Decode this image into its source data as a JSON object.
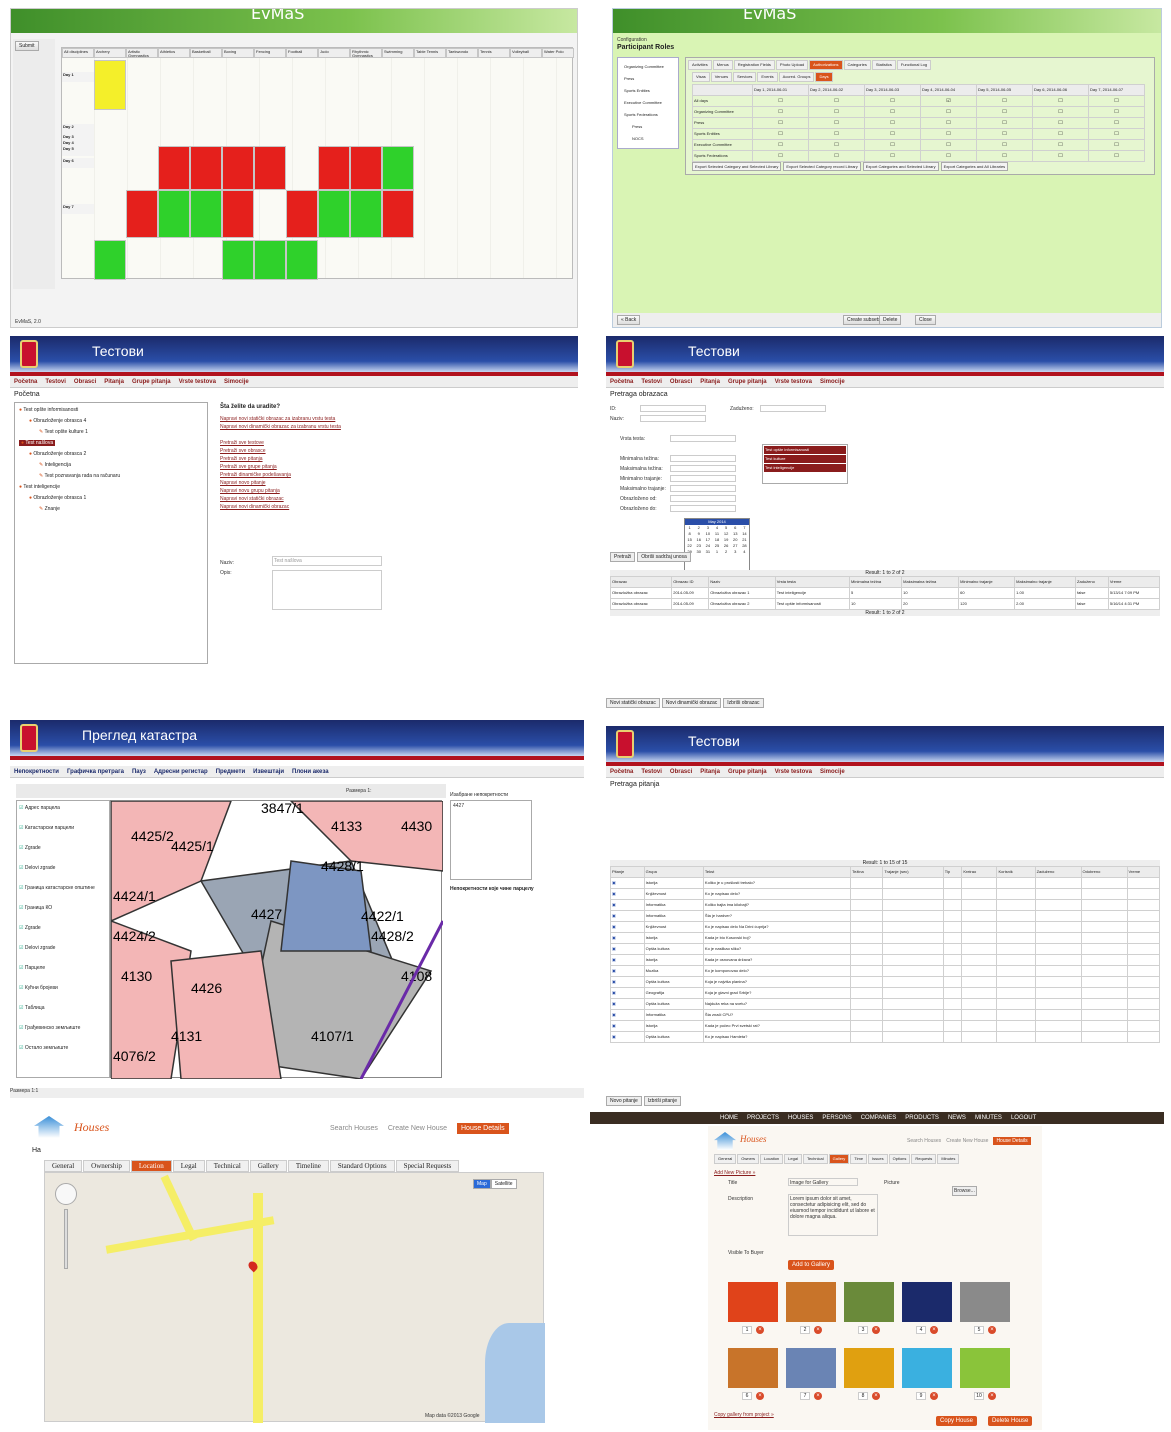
{
  "evmas_schedule": {
    "title": "EvMaS",
    "columns": [
      "All disciplines",
      "Archery",
      "Artistic Gymnastics",
      "Athletics",
      "Basketball",
      "Boxing",
      "Fencing",
      "Football",
      "Judo",
      "Rhythmic Gymnastics",
      "Swimming",
      "Table Tennis",
      "Taekwondo",
      "Tennis",
      "Volleyball",
      "Water Polo"
    ],
    "days": [
      "Day 1",
      "Day 2",
      "Day 3",
      "Day 4",
      "Day 5",
      "Day 6",
      "Day 7"
    ],
    "footer": "EvMaS, 2.0"
  },
  "evmas_config": {
    "title": "EvMaS",
    "breadcrumb": "Configuration",
    "page_title": "Participant Roles",
    "tabs": [
      "Activities",
      "Menus",
      "Registration Fields",
      "Photo Upload",
      "Authorizations",
      "Categories",
      "Statistics",
      "Functional Log"
    ],
    "subtabs": [
      "Visas",
      "Venues",
      "Services",
      "Events",
      "Accred. Groups",
      "Days"
    ],
    "tree": [
      "Organizing Committee",
      "Press",
      "Sports Entities",
      "Executive Committee",
      "Sports Federations",
      "Press",
      "NOCS"
    ],
    "day_headers": [
      "Day 1, 2014-06-01",
      "Day 2, 2014-06-02",
      "Day 3, 2014-06-03",
      "Day 4, 2014-06-04",
      "Day 5, 2014-06-05",
      "Day 6, 2014-06-06",
      "Day 7, 2014-06-07"
    ],
    "rows": [
      "All days",
      "Organizing Committee",
      "Press",
      "Sports Entities",
      "Executive Committee",
      "Sports Federations"
    ],
    "export_buttons": [
      "Export Selected Category and Selected Library",
      "Export Selected Category record Library",
      "Export Categories and Selected Library",
      "Export Categories and All Libraries"
    ],
    "buttons": [
      "« Back",
      "Create subsets",
      "Delete",
      "Close"
    ]
  },
  "testovi_home": {
    "appname": "Тестови",
    "menu": [
      "Početna",
      "Testovi",
      "Obrasci",
      "Pitanja",
      "Grupe pitanja",
      "Vrste testova",
      "Simocije"
    ],
    "page_title": "Početna",
    "tree": [
      "Test opšte informisanosti",
      "Obrazloženje obrasca 4",
      "Test opšte kulture 1",
      "Test našlova",
      "Obrazloženje obrasca 2",
      "Inteligencija",
      "Test poznavanja rada na računaru",
      "Test inteligencije",
      "Obrazloženje obrasca 1",
      "Znanje"
    ],
    "heading": "Šta želite da uradite?",
    "links": [
      "Napravi novi statički obrazac za izabranu vrstu testa",
      "Napravi novi dinamički obrazac za izabranu vrstu testa",
      "Pretraži sve testove",
      "Pretraži sve obrasce",
      "Pretraži sve pitanja",
      "Pretraži sve grupe pitanja",
      "Pretraži dinamičke podešavanja",
      "Napravi novo pitanje",
      "Napravi novu grupu pitanja",
      "Napravi novi statički obrazac",
      "Napravi novi dinamički obrazac"
    ],
    "form_labels": [
      "Naziv:",
      "Opis:"
    ],
    "form_value": "Test našlova"
  },
  "testovi_search": {
    "appname": "Тестови",
    "page_title": "Pretraga obrazaca",
    "labels": [
      "ID:",
      "Naziv:",
      "Zaduženo:",
      "Vrsta testa:",
      "Minimalna težina:",
      "Maksimalna težina:",
      "Minimalno trajanje:",
      "Maksimalno trajanje:",
      "Obrazloženo od:",
      "Obrazloženo do:"
    ],
    "test_types": [
      "Test opšte informisanosti",
      "Test kulture",
      "Test inteligencije"
    ],
    "calendar_month": "May 2014",
    "buttons": [
      "Pretraži",
      "Obriši sadržaj unosa"
    ],
    "result": "Result: 1 to 2 of 2",
    "columns": [
      "Obrazac",
      "Obrazac ID",
      "Naziv",
      "Vrsta testa",
      "Minimalna težina",
      "Maksimalna težina",
      "Minimalno trajanje",
      "Maksimalno trajanje",
      "Zaduženo",
      "Vreme"
    ],
    "rows": [
      [
        "Obrazložba obrazac",
        "2014-05-09",
        "Obrazložba obrazac 1",
        "Test inteligencije",
        "5",
        "10",
        "60",
        "1.00",
        "false",
        "5/13/14 7:09 PM"
      ],
      [
        "Obrazložba obrazac",
        "2014-05-09",
        "Obrazložba obrazac 2",
        "Test opšte informisanosti",
        "10",
        "20",
        "120",
        "2.00",
        "false",
        "5/16/14 4:31 PM"
      ]
    ],
    "bottom_buttons": [
      "Novi statički obrazac",
      "Novi dinamički obrazac",
      "Izbriši obrazac"
    ]
  },
  "katastar": {
    "appname": "Преглед катастра",
    "menu": [
      "Непокретности",
      "Графичка претрага",
      "Пауз",
      "Адресни регистар",
      "Предмети",
      "Извештаји",
      "Плони акеза"
    ],
    "layers": [
      "Адрес парцела",
      "Катастарски парцели",
      "Zgrade",
      "Delovi zgrade",
      "Граница катастарске општине",
      "Граница КО",
      "Zgrade",
      "Delovi zgrade",
      "Парцеле",
      "Кућни бројеви",
      "Таблица",
      "Грађевинско земљиште",
      "Остало земљиште"
    ],
    "parcels": [
      "4425/2",
      "4425/1",
      "3847/1",
      "4133",
      "4430",
      "4428/1",
      "4427",
      "4424/1",
      "4424/2",
      "4422/1",
      "4428/2",
      "4130",
      "4426",
      "4108",
      "4131",
      "4107/1",
      "4076/2"
    ],
    "right_title": "Изабране непокретности",
    "right_item": "4427",
    "right_note": "Непокретности које чине парцелу",
    "scale": "Размера 1:",
    "status": "Размера 1:1"
  },
  "testovi_questions": {
    "appname": "Тестови",
    "page_title": "Pretraga pitanja",
    "result": "Result: 1 to 15 of 15",
    "columns": [
      "Pitanje",
      "Grupa",
      "Tekst",
      "Težina",
      "Trajanje (sec)",
      "Tip",
      "Kreirao",
      "Korisnik",
      "Zaduženo",
      "Odobreno",
      "Vreme"
    ],
    "rows": [
      [
        "Istorija",
        "Koliko je u prošlosti trebalo?"
      ],
      [
        "Književnost",
        "Ko je napisao delo?"
      ],
      [
        "Informatika",
        "Koliko bajta ima kilobajt?"
      ],
      [
        "Informatika",
        "Šta je hardver?"
      ],
      [
        "Književnost",
        "Ko je napisao delo Na Drini ćuprija?"
      ],
      [
        "Istorija",
        "Kada je bio Kosovski boj?"
      ],
      [
        "Opšta kultura",
        "Ko je naslikao sliku?"
      ],
      [
        "Istorija",
        "Kada je osnovana država?"
      ],
      [
        "Muzika",
        "Ko je komponovao delo?"
      ],
      [
        "Opšta kultura",
        "Koja je najviša planina?"
      ],
      [
        "Geografija",
        "Koja je glavni grad Srbije?"
      ],
      [
        "Opšta kultura",
        "Najduža reka na svetu?"
      ],
      [
        "Informatika",
        "Šta znači CPU?"
      ],
      [
        "Istorija",
        "Kada je počeo Prvi svetski rat?"
      ],
      [
        "Opšta kultura",
        "Ko je napisao Hamleta?"
      ]
    ],
    "bottom_buttons": [
      "Novo pitanje",
      "Izbriši pitanje"
    ]
  },
  "houses_location": {
    "brand": "Houses",
    "links": [
      "Search Houses",
      "Create New House",
      "House Details"
    ],
    "tabs": [
      "General",
      "Ownership",
      "Location",
      "Legal",
      "Technical",
      "Gallery",
      "Timeline",
      "Standard Options",
      "Special Requests"
    ],
    "label": "Ha",
    "map_types": [
      "Map",
      "Satellite"
    ],
    "copyright": "Map data ©2013 Google"
  },
  "houses_gallery": {
    "nav": [
      "HOME",
      "PROJECTS",
      "HOUSES",
      "PERSONS",
      "COMPANIES",
      "PRODUCTS",
      "NEWS",
      "MINUTES",
      "LOGOUT"
    ],
    "brand": "Houses",
    "links": [
      "Search Houses",
      "Create New House",
      "House Details"
    ],
    "tabs": [
      "General",
      "Owners",
      "Location",
      "Legal",
      "Technical",
      "Gallery",
      "Time",
      "Issues",
      "Options",
      "Requests",
      "Minutes"
    ],
    "add_link": "Add New Picture »",
    "fields": {
      "title_label": "Title",
      "title_value": "Image for Gallery",
      "desc_label": "Description",
      "desc_value": "Lorem ipsum dolor sit amet, consectetur adipisicing elit, sed do eiusmod tempor incididunt ut labore et dolore magna aliqua.",
      "picture_label": "Picture",
      "browse": "Browse...",
      "visible": "Visible To Buyer"
    },
    "add_btn": "Add to Gallery",
    "numbers": [
      "1",
      "2",
      "3",
      "4",
      "5",
      "6",
      "7",
      "8",
      "9",
      "10"
    ],
    "copy_link": "Copy gallery from project »",
    "buttons": [
      "Copy House",
      "Delete House"
    ]
  }
}
